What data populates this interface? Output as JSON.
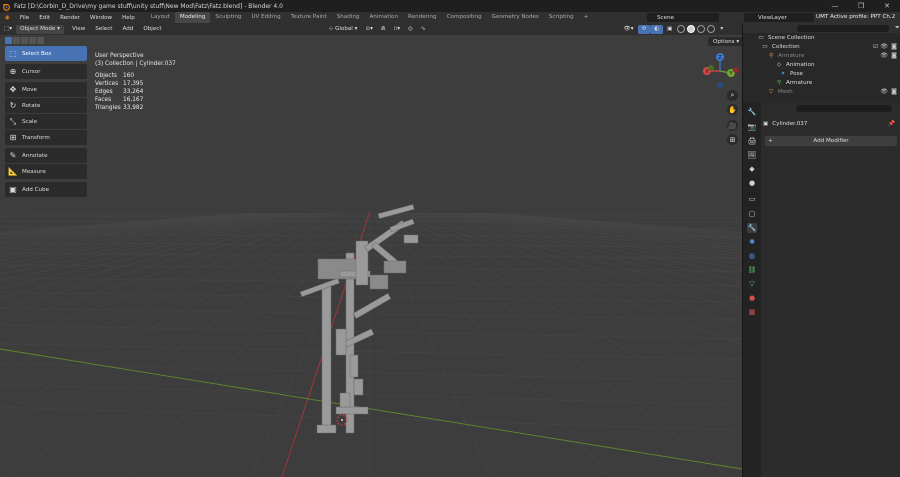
{
  "window": {
    "title": "Fatz [D:\\Corbin_D_Drive\\my game stuff\\unity stuff\\New Mod\\Fatz\\Fatz.blend] - Blender 4.0",
    "controls": [
      "—",
      "❐",
      "✕"
    ]
  },
  "topbar": {
    "menus": [
      "File",
      "Edit",
      "Render",
      "Window",
      "Help"
    ],
    "workspaces": [
      "Layout",
      "Modeling",
      "Sculpting",
      "UV Editing",
      "Texture Paint",
      "Shading",
      "Animation",
      "Rendering",
      "Compositing",
      "Geometry Nodes",
      "Scripting",
      "+"
    ],
    "active_workspace": "Modeling",
    "scene": "Scene",
    "view_layer": "ViewLayer",
    "profile": "UMT Active profile: PPT Ch.2"
  },
  "viewport_header": {
    "mode": "Object Mode",
    "menus": [
      "View",
      "Select",
      "Add",
      "Object"
    ],
    "orientation": "Global"
  },
  "overlay": {
    "view_name": "User Perspective",
    "context": "(3) Collection | Cylinder.037",
    "stats": [
      {
        "label": "Objects",
        "value": "160"
      },
      {
        "label": "Vertices",
        "value": "17,395"
      },
      {
        "label": "Edges",
        "value": "33,264"
      },
      {
        "label": "Faces",
        "value": "16,167"
      },
      {
        "label": "Triangles",
        "value": "33,982"
      }
    ],
    "options_label": "Options"
  },
  "tools": [
    {
      "label": "Select Box",
      "icon": "select-box-icon",
      "active": true
    },
    {
      "label": "Cursor",
      "icon": "cursor-icon"
    },
    {
      "label": "Move",
      "icon": "move-icon"
    },
    {
      "label": "Rotate",
      "icon": "rotate-icon"
    },
    {
      "label": "Scale",
      "icon": "scale-icon"
    },
    {
      "label": "Transform",
      "icon": "transform-icon"
    },
    {
      "label": "Annotate",
      "icon": "annotate-icon"
    },
    {
      "label": "Measure",
      "icon": "measure-icon"
    },
    {
      "label": "Add Cube",
      "icon": "add-cube-icon"
    }
  ],
  "gizmo": {
    "x": "X",
    "y": "Y",
    "z": "Z"
  },
  "outliner": {
    "items": [
      {
        "label": "Scene Collection",
        "indent": 0
      },
      {
        "label": "Collection",
        "indent": 1
      },
      {
        "label": "Armature",
        "indent": 2,
        "dim": true
      },
      {
        "label": "Animation",
        "indent": 3
      },
      {
        "label": "Pose",
        "indent": 3
      },
      {
        "label": "Armature",
        "indent": 3
      },
      {
        "label": "Mesh",
        "indent": 2,
        "dim": true
      }
    ]
  },
  "properties": {
    "object_name": "Cylinder.037",
    "add_modifier_label": "Add Modifier"
  },
  "colors": {
    "accent": "#4772b3",
    "viewport_bg": "#3d3d3d",
    "x_axis": "#d8464b",
    "y_axis": "#74a436",
    "z_axis": "#3b7bd1"
  }
}
